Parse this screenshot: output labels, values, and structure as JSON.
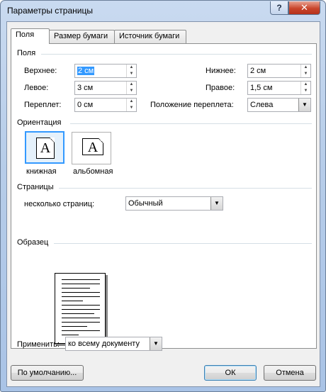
{
  "window": {
    "title": "Параметры страницы",
    "help_label": "?",
    "close_label": "✕"
  },
  "tabs": [
    {
      "label": "Поля",
      "active": true
    },
    {
      "label": "Размер бумаги",
      "active": false
    },
    {
      "label": "Источник бумаги",
      "active": false
    }
  ],
  "margins": {
    "group_label": "Поля",
    "top_label": "Верхнее:",
    "top_value": "2 см",
    "left_label": "Левое:",
    "left_value": "3 см",
    "gutter_label": "Переплет:",
    "gutter_value": "0 см",
    "bottom_label": "Нижнее:",
    "bottom_value": "2 см",
    "right_label": "Правое:",
    "right_value": "1,5 см",
    "gutter_pos_label": "Положение переплета:",
    "gutter_pos_value": "Слева"
  },
  "orientation": {
    "group_label": "Ориентация",
    "portrait_label": "книжная",
    "landscape_label": "альбомная",
    "icon_letter": "A",
    "selected": "portrait"
  },
  "pages": {
    "group_label": "Страницы",
    "multiple_label": "несколько страниц:",
    "multiple_value": "Обычный"
  },
  "sample": {
    "group_label": "Образец"
  },
  "apply": {
    "label": "Применить:",
    "value": "ко всему документу"
  },
  "buttons": {
    "default_label": "По умолчанию...",
    "ok_label": "ОК",
    "cancel_label": "Отмена"
  },
  "icons": {
    "spin_up": "▲",
    "spin_down": "▼",
    "dropdown": "▼"
  }
}
